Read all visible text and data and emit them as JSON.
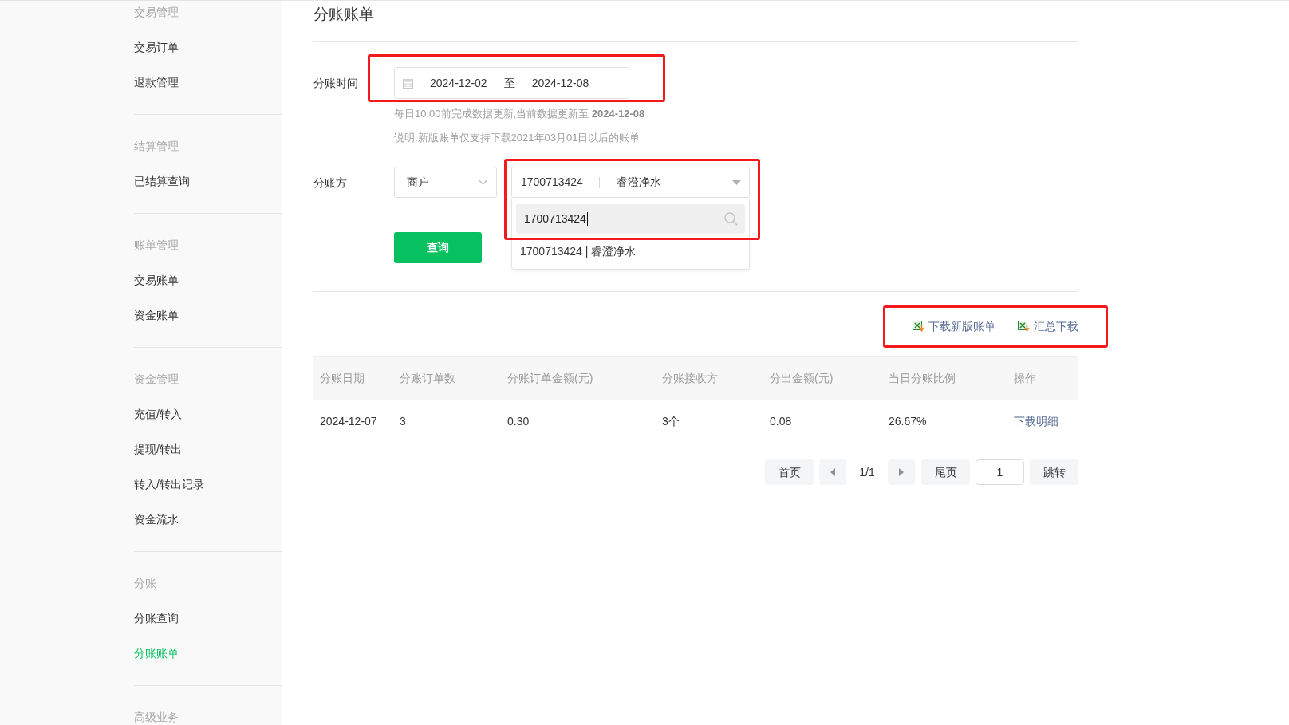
{
  "sidebar": {
    "groups": [
      {
        "title": "交易管理",
        "items": [
          {
            "label": "交易订单",
            "selected": false
          },
          {
            "label": "退款管理",
            "selected": false
          }
        ]
      },
      {
        "title": "结算管理",
        "items": [
          {
            "label": "已结算查询",
            "selected": false
          }
        ]
      },
      {
        "title": "账单管理",
        "items": [
          {
            "label": "交易账单",
            "selected": false
          },
          {
            "label": "资金账单",
            "selected": false
          }
        ]
      },
      {
        "title": "资金管理",
        "items": [
          {
            "label": "充值/转入",
            "selected": false
          },
          {
            "label": "提现/转出",
            "selected": false
          },
          {
            "label": "转入/转出记录",
            "selected": false
          },
          {
            "label": "资金流水",
            "selected": false
          }
        ]
      },
      {
        "title": "分账",
        "items": [
          {
            "label": "分账查询",
            "selected": false
          },
          {
            "label": "分账账单",
            "selected": true
          }
        ]
      },
      {
        "title": "高级业务"
      }
    ]
  },
  "page_title": "分账账单",
  "filters": {
    "time": {
      "label": "分账时间",
      "start": "2024-12-02",
      "separator": "至",
      "end": "2024-12-08",
      "highlighted": true
    },
    "hints": [
      "每日10:00前完成数据更新,当前数据更新至 **2024-12-08**",
      "说明:新版账单仅支持下载2021年03月01日以后的账单"
    ],
    "party": {
      "label": "分账方",
      "type_select": {
        "value": "商户"
      },
      "account_select": {
        "id": "1700713424",
        "name": "睿澄净水",
        "expanded": true,
        "highlighted": true,
        "search": {
          "value": "1700713424"
        },
        "options": [
          "1700713424 | 睿澄净水"
        ]
      }
    },
    "query_button": "查询"
  },
  "downloads": {
    "highlighted": true,
    "links": [
      {
        "label": "下载新版账单"
      },
      {
        "label": "汇总下载"
      }
    ]
  },
  "table": {
    "columns": [
      "分账日期",
      "分账订单数",
      "分账订单金额(元)",
      "分账接收方",
      "分出金额(元)",
      "当日分账比例",
      "操作"
    ],
    "rows": [
      {
        "cells": [
          "2024-12-07",
          "3",
          "0.30",
          "3个",
          "0.08",
          "26.67%"
        ],
        "action": "下载明细"
      }
    ]
  },
  "pagination": {
    "first": "首页",
    "indicator": "1/1",
    "last": "尾页",
    "jump_value": "1",
    "jump": "跳转"
  }
}
